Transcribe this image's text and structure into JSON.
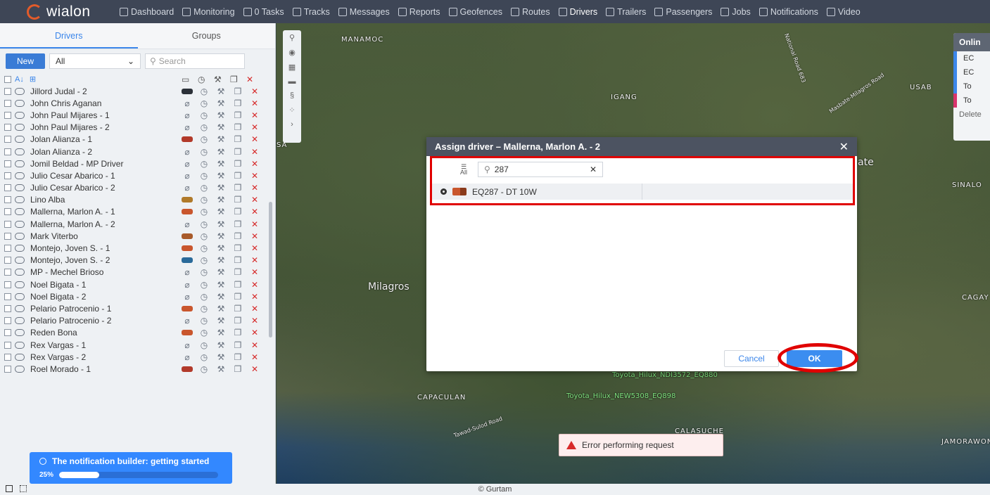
{
  "brand": {
    "name": "wialon"
  },
  "nav": [
    {
      "label": "Dashboard",
      "icon": "chart-icon"
    },
    {
      "label": "Monitoring",
      "icon": "globe-icon"
    },
    {
      "label": "0 Tasks",
      "icon": "check-circle-icon"
    },
    {
      "label": "Tracks",
      "icon": "track-icon"
    },
    {
      "label": "Messages",
      "icon": "messages-icon"
    },
    {
      "label": "Reports",
      "icon": "reports-icon"
    },
    {
      "label": "Geofences",
      "icon": "geofence-icon"
    },
    {
      "label": "Routes",
      "icon": "routes-icon"
    },
    {
      "label": "Drivers",
      "icon": "driver-icon"
    },
    {
      "label": "Trailers",
      "icon": "trailer-icon"
    },
    {
      "label": "Passengers",
      "icon": "passenger-icon"
    },
    {
      "label": "Jobs",
      "icon": "jobs-icon"
    },
    {
      "label": "Notifications",
      "icon": "notification-icon"
    },
    {
      "label": "Video",
      "icon": "video-icon"
    }
  ],
  "panel": {
    "tabs": [
      "Drivers",
      "Groups"
    ],
    "new_label": "New",
    "filter_value": "All",
    "search_placeholder": "Search",
    "sort_label": "A↓",
    "drivers": [
      {
        "name": "Jillord Judal - 2",
        "unit": "#2b3038"
      },
      {
        "name": "John Chris Aganan",
        "unit": ""
      },
      {
        "name": "John Paul Mijares - 1",
        "unit": ""
      },
      {
        "name": "John Paul Mijares - 2",
        "unit": ""
      },
      {
        "name": "Jolan Alianza - 1",
        "unit": "#b23a2a"
      },
      {
        "name": "Jolan Alianza - 2",
        "unit": ""
      },
      {
        "name": "Jomil Beldad - MP Driver",
        "unit": ""
      },
      {
        "name": "Julio Cesar Abarico - 1",
        "unit": ""
      },
      {
        "name": "Julio Cesar Abarico - 2",
        "unit": ""
      },
      {
        "name": "Lino Alba",
        "unit": "#b07a2a"
      },
      {
        "name": "Mallerna, Marlon A. - 1",
        "unit": "#c9562d"
      },
      {
        "name": "Mallerna, Marlon A. - 2",
        "unit": ""
      },
      {
        "name": "Mark Viterbo",
        "unit": "#a85a2a"
      },
      {
        "name": "Montejo, Joven S. - 1",
        "unit": "#c9562d"
      },
      {
        "name": "Montejo, Joven S. - 2",
        "unit": "#2a6a9a"
      },
      {
        "name": "MP - Mechel Brioso",
        "unit": ""
      },
      {
        "name": "Noel Bigata - 1",
        "unit": ""
      },
      {
        "name": "Noel Bigata - 2",
        "unit": ""
      },
      {
        "name": "Pelario Patrocenio - 1",
        "unit": "#c9562d"
      },
      {
        "name": "Pelario Patrocenio - 2",
        "unit": ""
      },
      {
        "name": "Reden Bona",
        "unit": "#c9562d"
      },
      {
        "name": "Rex Vargas - 1",
        "unit": ""
      },
      {
        "name": "Rex Vargas - 2",
        "unit": ""
      },
      {
        "name": "Roel Morado - 1",
        "unit": "#b23a2a"
      }
    ]
  },
  "notification": {
    "title": "The notification builder: getting started",
    "progress_label": "25%",
    "progress": 0.25
  },
  "map": {
    "labels": [
      "MANAMOC",
      "IGANG",
      "USAB",
      "SINALO",
      "Milagros",
      "CAGAY",
      "CAPACULAN",
      "CALASUCHE",
      "JAMORAWON",
      "ate",
      "SA"
    ],
    "roads": [
      "National Road 683",
      "Masbate-Milagros Road",
      "Tawad-Sulod Road"
    ],
    "unit_labels": [
      "Toyota_Hilux_NDI3572_EQ880",
      "Toyota_Hilux_NEW5308_EQ898"
    ],
    "copyright": "© Gurtam"
  },
  "online_panel": {
    "title": "Onlin",
    "items": [
      "EC",
      "EC",
      "To",
      "To"
    ],
    "bar_colors": [
      "#3b86ea",
      "#3b86ea",
      "#3b86ea",
      "#d8336c"
    ],
    "delete_label": "Delete"
  },
  "modal": {
    "title": "Assign driver – Mallerna, Marlon A. - 2",
    "filter_label": "All",
    "search_value": "287",
    "result": "EQ287 - DT 10W",
    "cancel_label": "Cancel",
    "ok_label": "OK"
  },
  "error": {
    "text": "Error performing request"
  }
}
